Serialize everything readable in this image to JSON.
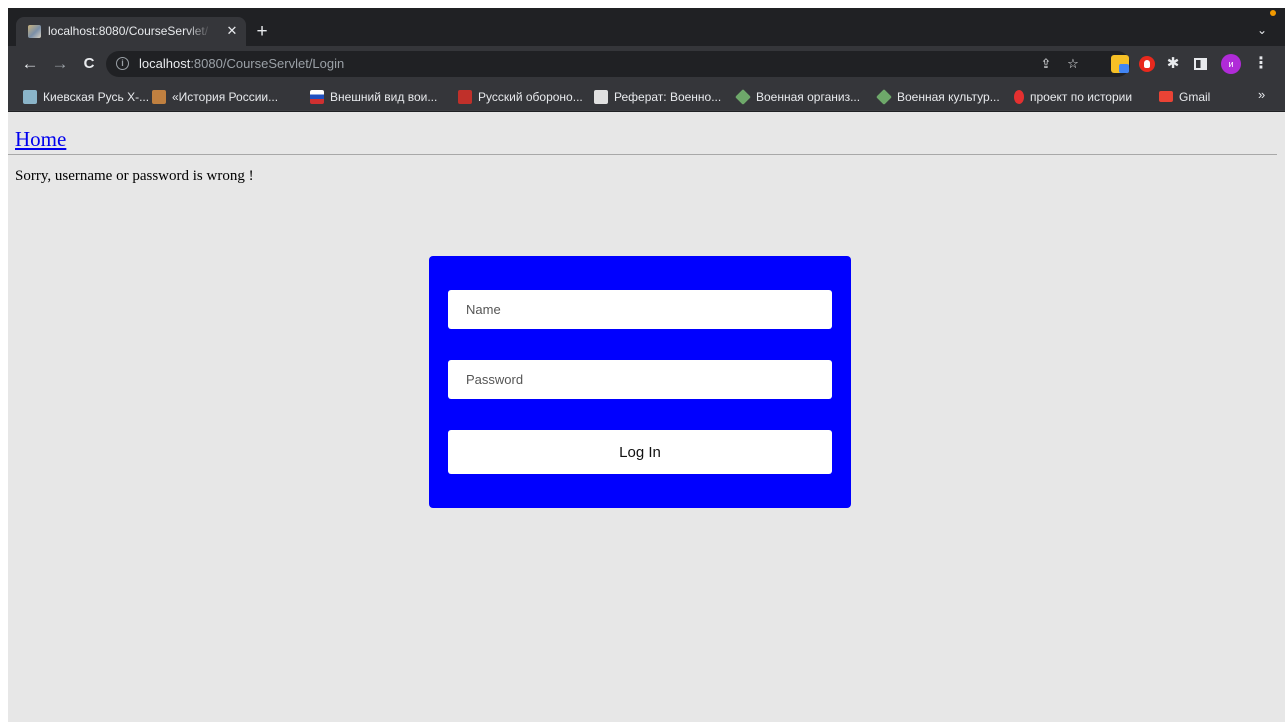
{
  "browser": {
    "tab": {
      "title": "localhost:8080/CourseServlet/",
      "favicon": "course-favicon"
    },
    "new_tab_glyph": "+",
    "tab_close_glyph": "✕",
    "tab_search_glyph": "⌄",
    "nav": {
      "back": "←",
      "forward": "→",
      "reload": "C"
    },
    "address": {
      "host": "localhost",
      "rest": ":8080/CourseServlet/Login",
      "info_glyph": "i"
    },
    "omnibox_icons": {
      "share": "⇪",
      "bookmark": "☆"
    },
    "extensions": {
      "puzzle": "✱",
      "avatar_initial": "и",
      "menu": "⋮"
    },
    "bookmarks": [
      {
        "label": "Киевская Русь X-...",
        "icon_color": "#8ab4c8"
      },
      {
        "label": "«История России...",
        "icon_color": "#c08040"
      },
      {
        "label": "Внешний вид вои...",
        "icon_color": "#d03030"
      },
      {
        "label": "Русский обороно...",
        "icon_color": "#c0302a"
      },
      {
        "label": "Реферат: Военно...",
        "icon_color": "#e0e0e0"
      },
      {
        "label": "Военная организ...",
        "icon_color": "#6ea86a"
      },
      {
        "label": "Военная культур...",
        "icon_color": "#6ea86a"
      },
      {
        "label": "проект по истории",
        "icon_color": "#e53030"
      },
      {
        "label": "Gmail",
        "icon_color": "#ea4335"
      }
    ],
    "bookmarks_more": "»"
  },
  "page": {
    "home_link": "Home",
    "error_message": "Sorry, username or password is wrong !",
    "form": {
      "name_placeholder": "Name",
      "password_placeholder": "Password",
      "submit_label": "Log In",
      "box_color": "#0000ff"
    }
  }
}
